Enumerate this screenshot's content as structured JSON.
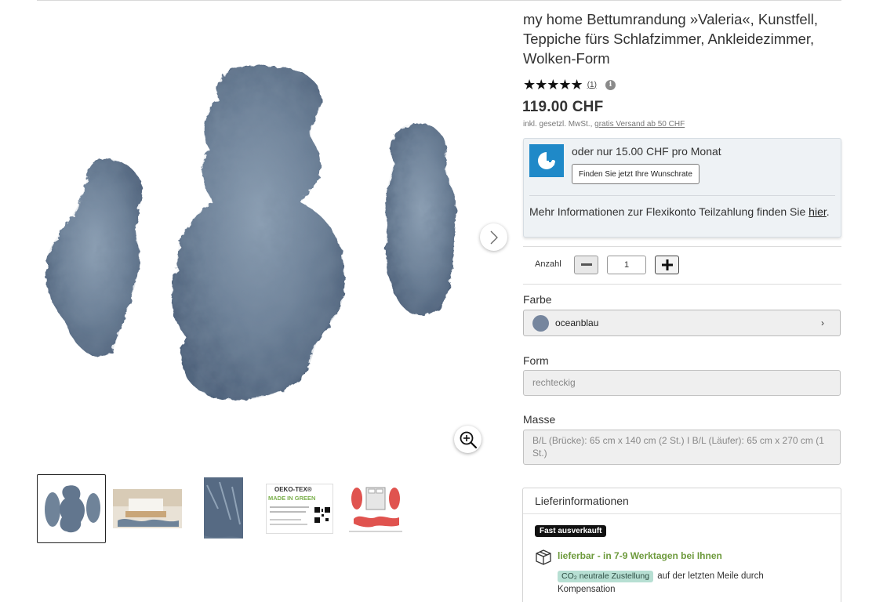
{
  "product": {
    "title": "my home Bettumrandung »Valeria«, Kunstfell, Teppiche fürs Schlafzimmer, Ankleidezimmer, Wolken-Form",
    "stars": "★★★★★",
    "rating_count": "(1)",
    "rating_value": 5,
    "price": "119.00 CHF",
    "vat_text": "inkl. gesetzl. MwSt.,",
    "shipping_link": "gratis Versand ab 50 CHF"
  },
  "finance": {
    "monthly_text": "oder nur 15.00 CHF pro Monat",
    "button_label": "Finden Sie jetzt Ihre Wunschrate",
    "more_text": "Mehr Informationen zur Flexikonto Teilzahlung finden Sie",
    "more_link": "hier",
    "period": "."
  },
  "quantity": {
    "label": "Anzahl",
    "value": "1"
  },
  "options": {
    "color_label": "Farbe",
    "color_value": "oceanblau",
    "swatch_color": "#76869e",
    "shape_label": "Form",
    "shape_value": "rechteckig",
    "size_label": "Masse",
    "size_value": "B/L (Brücke): 65 cm x 140 cm (2 St.) I B/L (Läufer): 65 cm x 270 cm (1 St.)"
  },
  "delivery": {
    "title": "Lieferinformationen",
    "stock_badge": "Fast ausverkauft",
    "availability": "lieferbar - in 7-9 Werktagen bei Ihnen",
    "co2_badge": "CO₂ neutrale Zustellung",
    "co2_text": "auf der letzten Meile durch Kompensation"
  },
  "thumbnails": {
    "oeko_title": "OEKO-TEX®",
    "oeko_sub": "MADE IN GREEN"
  },
  "colors": {
    "accent_blue": "#1f89c8",
    "available_green": "#6d9a3c",
    "co2_badge_bg": "#b7dfd3"
  }
}
